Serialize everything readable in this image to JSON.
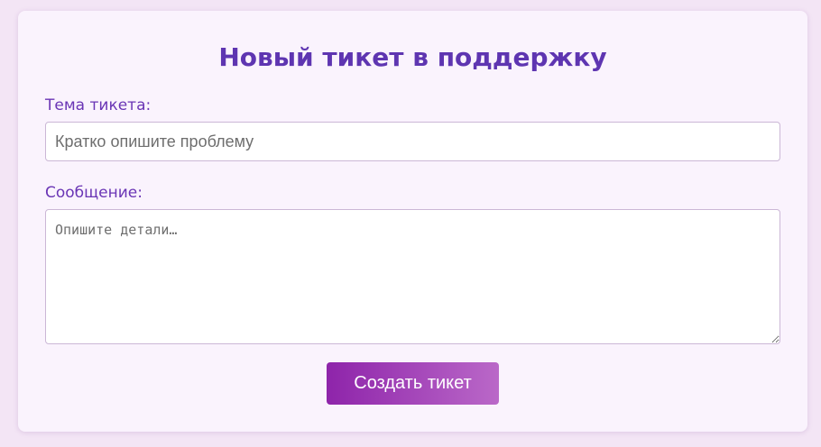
{
  "form": {
    "title": "Новый тикет в поддержку",
    "subject": {
      "label": "Тема тикета:",
      "value": "",
      "placeholder": "Кратко опишите проблему"
    },
    "message": {
      "label": "Сообщение:",
      "value": "",
      "placeholder": "Опишите детали…"
    },
    "submit_label": "Создать тикет"
  },
  "colors": {
    "page_background": "#f3e5f5",
    "card_background": "#faf3fd",
    "title": "#5e35b1",
    "label": "#6a35b5",
    "button_gradient_start": "#8e24aa",
    "button_gradient_end": "#ba68c8",
    "button_text": "#ffffff"
  }
}
